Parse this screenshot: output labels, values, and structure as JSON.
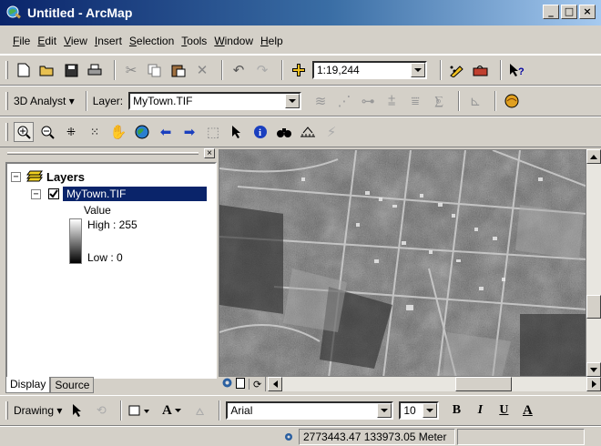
{
  "window": {
    "title": "Untitled - ArcMap",
    "buttons": {
      "minimize": "_",
      "maximize": "□",
      "close": "×"
    }
  },
  "menu": {
    "items": [
      {
        "hotkey": "F",
        "rest": "ile"
      },
      {
        "hotkey": "E",
        "rest": "dit"
      },
      {
        "hotkey": "V",
        "rest": "iew"
      },
      {
        "hotkey": "I",
        "rest": "nsert"
      },
      {
        "hotkey": "S",
        "rest": "election"
      },
      {
        "hotkey": "T",
        "rest": "ools"
      },
      {
        "hotkey": "W",
        "rest": "indow"
      },
      {
        "hotkey": "H",
        "rest": "elp"
      }
    ]
  },
  "standard_toolbar": {
    "scale_value": "1:19,244",
    "icons": [
      "new-document-icon",
      "open-folder-icon",
      "save-icon",
      "print-icon",
      "cut-icon",
      "copy-icon",
      "paste-icon",
      "delete-icon",
      "undo-icon",
      "redo-icon",
      "add-data-icon",
      "editor-icon",
      "arctoolbox-icon",
      "whats-this-icon"
    ]
  },
  "analyst_toolbar": {
    "analyst_label": "3D Analyst",
    "layer_label": "Layer:",
    "layer_value": "MyTown.TIF"
  },
  "tools_toolbar": {
    "icons": [
      "zoom-in-icon",
      "zoom-out-icon",
      "fixed-zoom-in-icon",
      "fixed-zoom-out-icon",
      "pan-icon",
      "full-extent-icon",
      "back-icon",
      "forward-icon",
      "select-features-icon",
      "select-elements-icon",
      "identify-icon",
      "find-icon",
      "measure-icon",
      "hyperlink-icon"
    ]
  },
  "toc": {
    "root_label": "Layers",
    "layer_name": "MyTown.TIF",
    "legend_title": "Value",
    "high_label": "High : 255",
    "low_label": "Low : 0",
    "tabs": {
      "display": "Display",
      "source": "Source"
    }
  },
  "drawing_toolbar": {
    "drawing_label": "Drawing",
    "font_value": "Arial",
    "size_value": "10",
    "bold": "B",
    "italic": "I",
    "underline": "U",
    "font_color": "A",
    "text_tool": "A"
  },
  "status": {
    "coordinates": "2773443.47  133973.05 Meter"
  },
  "colors": {
    "title_start": "#0a246a",
    "selection": "#0a246a",
    "face": "#d4d0c8"
  }
}
